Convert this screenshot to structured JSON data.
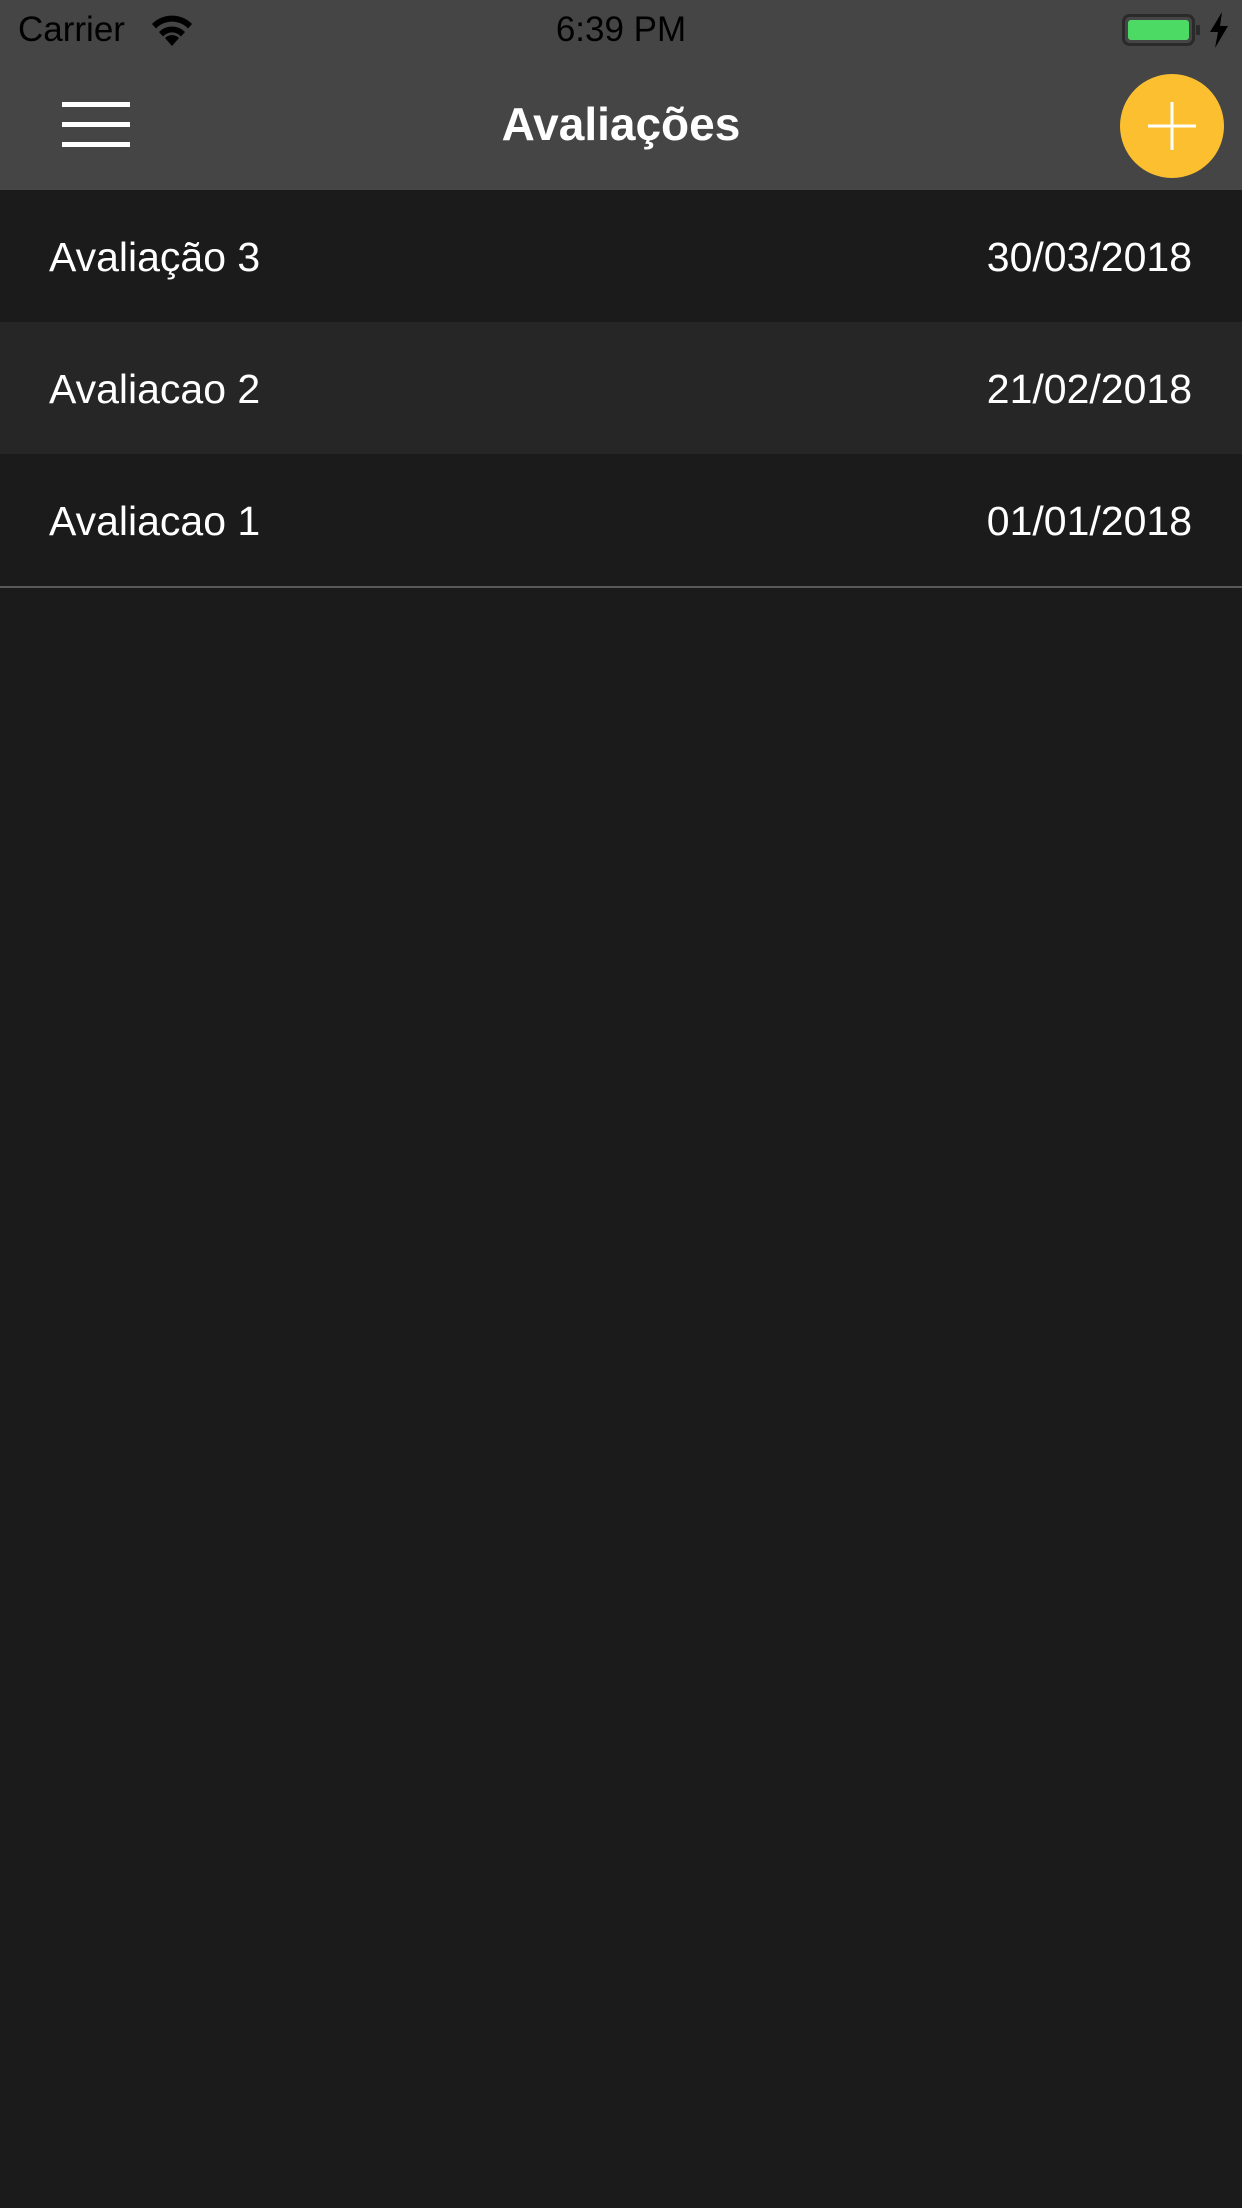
{
  "status_bar": {
    "carrier": "Carrier",
    "time": "6:39 PM",
    "icons": [
      "wifi-icon",
      "battery-icon",
      "charging-bolt-icon"
    ],
    "battery_color": "#4cd964"
  },
  "nav": {
    "title": "Avaliações",
    "menu_icon": "hamburger-menu-icon",
    "add_icon": "plus-icon",
    "bar_color": "#454545",
    "accent_color": "#fcbf30"
  },
  "evaluations": [
    {
      "name": "Avaliação 3",
      "date": "30/03/2018"
    },
    {
      "name": "Avaliacao 2",
      "date": "21/02/2018"
    },
    {
      "name": "Avaliacao 1",
      "date": "01/01/2018"
    }
  ],
  "colors": {
    "background": "#1b1b1b",
    "row_alt": "#262626",
    "text": "#ffffff"
  }
}
